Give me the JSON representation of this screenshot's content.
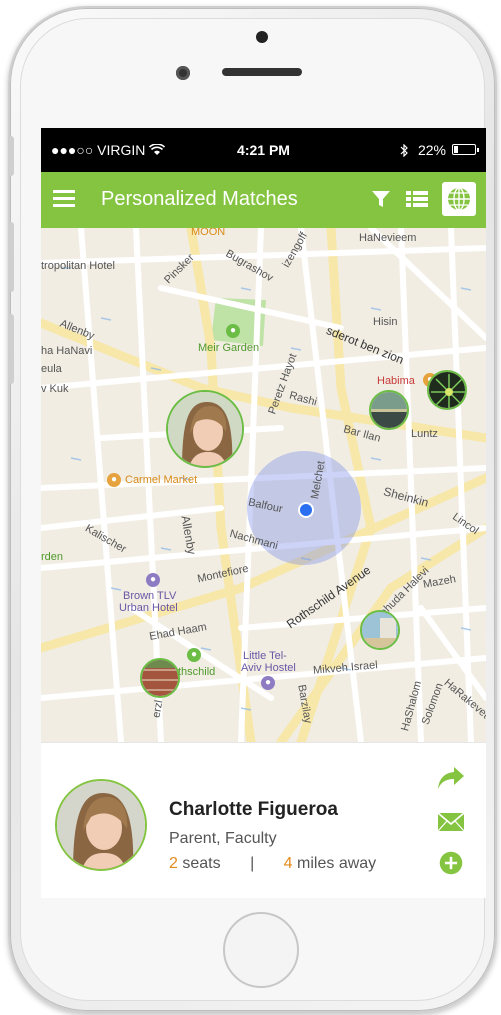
{
  "status_bar": {
    "carrier": "●●●○○ VIRGIN",
    "time": "4:21 PM",
    "battery_text": "22%",
    "battery_level": 0.22
  },
  "app_bar": {
    "title": "Personalized Matches"
  },
  "map": {
    "labels": {
      "moon": "MOON",
      "hanevieem": "HaNevieem",
      "metropolitan_hotel": "tropolitan Hotel",
      "pinsker": "Pinsker",
      "bugrashov": "Bugrashov",
      "bizengoff": "izengoff",
      "allenby_top": "Allenby",
      "hahavi": "ha HaNavi",
      "geula": "eula",
      "kuk": "v Kuk",
      "meir_garden": "Meir Garden",
      "hisin": "Hisin",
      "sderot_ben_zion": "sderot ben zion",
      "habima": "Habima",
      "perez_hayot": "Peretz Hayot",
      "rashi": "Rashi",
      "bar_ilan": "Bar Ilan",
      "luntz": "Luntz",
      "carmel_market": "Carmel Market",
      "balfour": "Balfour",
      "melchet": "Melchet",
      "sheinkin": "Sheinkin",
      "lincoln": "Lincol",
      "allenby_mid": "Allenby",
      "kalischer": "Kalischer",
      "nachmani": "Nachmani",
      "garden_left": "rden",
      "montefiore": "Montefiore",
      "rothschild_ave": "Rothschild Avenue",
      "yehuda_halevi": "Yehuda Halevi",
      "mazeh": "Mazeh",
      "brown_tlv": "Brown TLV",
      "urban_hotel": "Urban Hotel",
      "ehad_haam": "Ehad Haam",
      "rothschild": "thschild",
      "little_tel_aviv": "Little Tel-",
      "aviv_hostel": "Aviv Hostel",
      "mikveh_israel": "Mikveh Israel",
      "hashalom": "HaShalom",
      "solomon": "Solomon",
      "barzilay": "Barzilay",
      "herzl": "erzl",
      "hakevet": "HaRakevet"
    }
  },
  "card": {
    "name": "Charlotte Figueroa",
    "role": "Parent, Faculty",
    "seats_count": "2",
    "seats_label": "seats",
    "separator": "|",
    "miles_count": "4",
    "miles_label": "miles away"
  },
  "colors": {
    "accent": "#84c440",
    "highlight": "#e48b1c"
  }
}
